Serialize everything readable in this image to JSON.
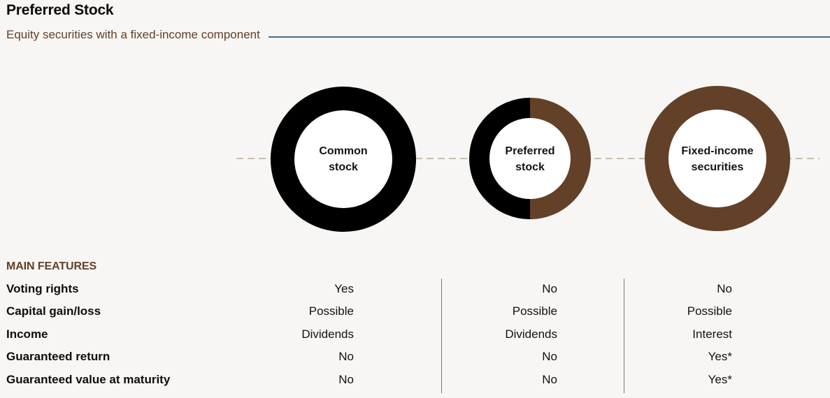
{
  "header": {
    "title": "Preferred Stock",
    "subtitle": "Equity securities with a fixed-income component"
  },
  "colors": {
    "accent_brown": "#634028",
    "black": "#000000",
    "rule_blue": "#4e6a8a",
    "dash": "#cbbfb0",
    "background": "#f7f6f4"
  },
  "circles": [
    {
      "id": "common-stock",
      "label_lines": [
        "Common",
        "stock"
      ],
      "fill": "black",
      "composition": {
        "equity": 1.0,
        "fixed_income": 0.0
      }
    },
    {
      "id": "preferred-stock",
      "label_lines": [
        "Preferred",
        "stock"
      ],
      "fill": "split",
      "composition": {
        "equity": 0.5,
        "fixed_income": 0.5
      }
    },
    {
      "id": "fixed-income-securities",
      "label_lines": [
        "Fixed-income",
        "securities"
      ],
      "fill": "brown",
      "composition": {
        "equity": 0.0,
        "fixed_income": 1.0
      }
    }
  ],
  "features": {
    "heading": "MAIN FEATURES",
    "rows": [
      {
        "label": "Voting rights",
        "values": [
          "Yes",
          "No",
          "No"
        ]
      },
      {
        "label": "Capital gain/loss",
        "values": [
          "Possible",
          "Possible",
          "Possible"
        ]
      },
      {
        "label": "Income",
        "values": [
          "Dividends",
          "Dividends",
          "Interest"
        ]
      },
      {
        "label": "Guaranteed return",
        "values": [
          "No",
          "No",
          "Yes*"
        ]
      },
      {
        "label": "Guaranteed value at maturity",
        "values": [
          "No",
          "No",
          "Yes*"
        ]
      }
    ]
  }
}
